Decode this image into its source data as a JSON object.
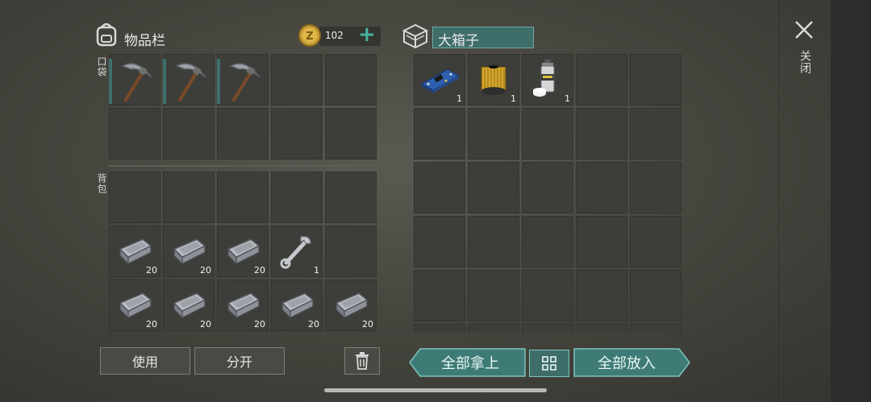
{
  "inventory": {
    "title": "物品栏",
    "coins": "102",
    "plus": "+",
    "pocket_label": "口袋",
    "backpack_label": "背包",
    "pocket_slots": [
      {
        "item": "pickaxe",
        "qty": ""
      },
      {
        "item": "pickaxe",
        "qty": ""
      },
      {
        "item": "pickaxe",
        "qty": ""
      },
      {
        "item": "",
        "qty": ""
      },
      {
        "item": "",
        "qty": ""
      },
      {
        "item": "",
        "qty": ""
      },
      {
        "item": "",
        "qty": ""
      },
      {
        "item": "",
        "qty": ""
      },
      {
        "item": "",
        "qty": ""
      },
      {
        "item": "",
        "qty": ""
      }
    ],
    "backpack_slots": [
      {
        "item": "",
        "qty": ""
      },
      {
        "item": "",
        "qty": ""
      },
      {
        "item": "",
        "qty": ""
      },
      {
        "item": "",
        "qty": ""
      },
      {
        "item": "",
        "qty": ""
      },
      {
        "item": "iron-ingot",
        "qty": "20"
      },
      {
        "item": "iron-ingot",
        "qty": "20"
      },
      {
        "item": "iron-ingot",
        "qty": "20"
      },
      {
        "item": "wrench",
        "qty": "1"
      },
      {
        "item": "",
        "qty": ""
      },
      {
        "item": "iron-ingot",
        "qty": "20"
      },
      {
        "item": "iron-ingot",
        "qty": "20"
      },
      {
        "item": "iron-ingot",
        "qty": "20"
      },
      {
        "item": "iron-ingot",
        "qty": "20"
      },
      {
        "item": "iron-ingot",
        "qty": "20"
      }
    ],
    "use_label": "使用",
    "split_label": "分开"
  },
  "chest": {
    "title": "大箱子",
    "slots": [
      {
        "item": "circuit-board",
        "qty": "1"
      },
      {
        "item": "oil-filter",
        "qty": "1"
      },
      {
        "item": "spray-can",
        "qty": "1"
      }
    ],
    "take_all_label": "全部拿上",
    "put_all_label": "全部放入"
  },
  "close_label": "关闭",
  "colors": {
    "teal": "#3f7b76",
    "slot": "#3d3e3a"
  }
}
